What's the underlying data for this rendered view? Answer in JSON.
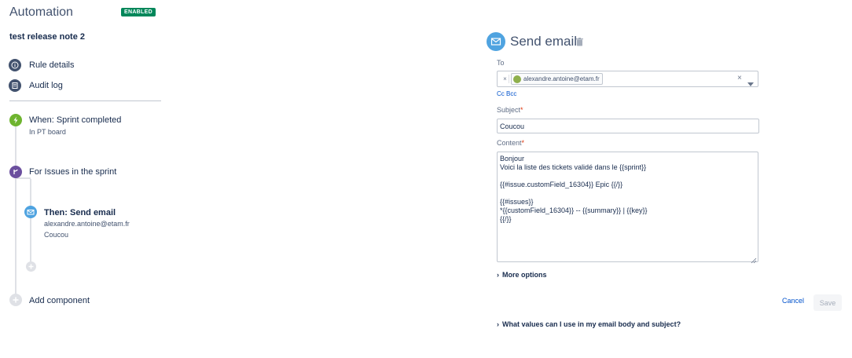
{
  "header": {
    "app_title": "Automation",
    "status_badge": "ENABLED"
  },
  "rule": {
    "name": "test release note 2"
  },
  "nav": {
    "items": [
      {
        "label": "Rule details",
        "icon": "info-icon"
      },
      {
        "label": "Audit log",
        "icon": "list-icon"
      }
    ]
  },
  "flow": {
    "trigger": {
      "title": "When: Sprint completed",
      "subtitle": "In PT board",
      "icon": "lightning-icon"
    },
    "branch": {
      "title": "For Issues in the sprint",
      "icon": "branch-icon"
    },
    "action": {
      "title": "Then: Send email",
      "line1": "alexandre.antoine@etam.fr",
      "line2": "Coucou",
      "icon": "envelope-icon"
    },
    "add_component": "Add component"
  },
  "editor": {
    "title": "Send email",
    "to_label": "To",
    "to_chip": "alexandre.antoine@etam.fr",
    "chip_remove": "×",
    "clear": "×",
    "cc_bcc": "Cc Bcc",
    "subject_label": "Subject",
    "subject_value": "Coucou",
    "content_label": "Content",
    "required_mark": "*",
    "content_value": "Bonjour\nVoici la liste des tickets validé dans le {{sprint}}\n\n{{#issue.customField_16304}} Epic {{/}}\n\n{{#issues}}\n*{{customField_16304}} -- {{summary}} | {{key}}\n{{/}}",
    "more_options": "More options",
    "cancel": "Cancel",
    "save": "Save",
    "help": "What values can I use in my email body and subject?"
  },
  "colors": {
    "badge": "#00875a",
    "accent_link": "#0052cc",
    "email_icon": "#4fa3e0",
    "trigger_icon": "#6eb42f",
    "branch_icon": "#6b4f9e",
    "nav_icon": "#42526e"
  }
}
